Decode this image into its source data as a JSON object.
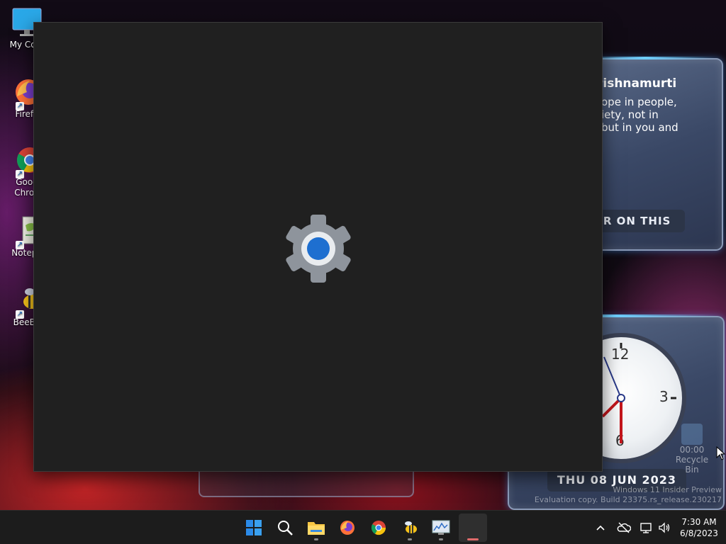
{
  "desktop": {
    "icons": [
      {
        "label": "My Com"
      },
      {
        "label": "Firefo"
      },
      {
        "label": "Goog\nChron"
      },
      {
        "label": "Notepa"
      },
      {
        "label": "BeeBE"
      }
    ]
  },
  "quote_gadget": {
    "title": "rishnamurti",
    "body_line1": "ope in people,",
    "body_line2": "iety, not in",
    "body_line3": "but in you and",
    "button": "ER ON THIS"
  },
  "clock_gadget": {
    "num_12": "12",
    "num_3": "3",
    "num_6": "6",
    "date": "THU 08 JUN 2023"
  },
  "recycle_bin": {
    "time": "00:00",
    "label": "Recycle Bin"
  },
  "watermark": {
    "line1": "Windows 11 Insider Preview",
    "line2": "Evaluation copy. Build 23375.rs_release.230217"
  },
  "taskbar": {
    "time": "7:30 AM",
    "date": "6/8/2023"
  },
  "colors": {
    "splash_bg": "#202020",
    "taskbar_bg": "#1c1c1c",
    "gear_gray": "#8e949c",
    "gear_accent": "#1e6fd0"
  }
}
